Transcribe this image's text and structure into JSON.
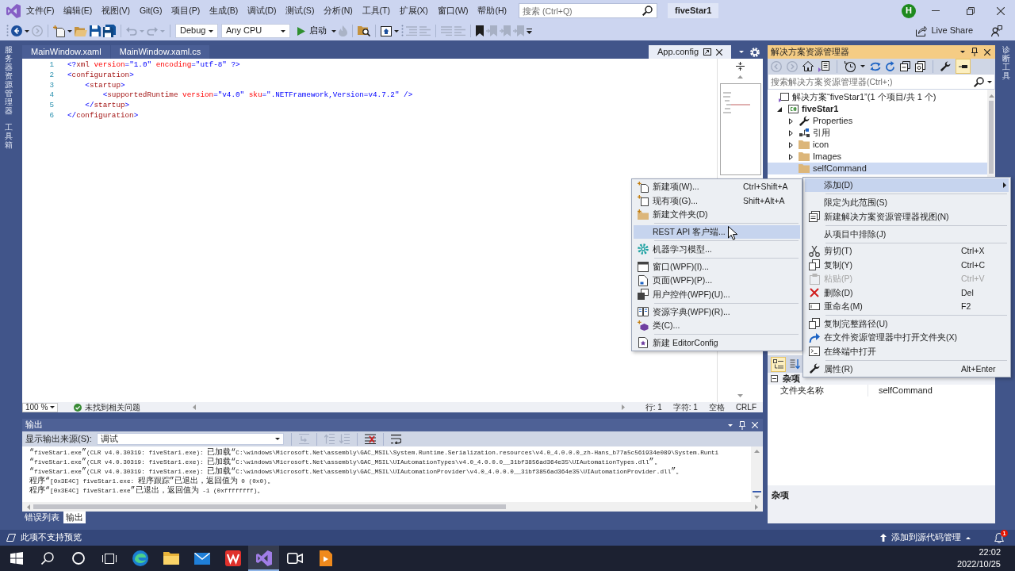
{
  "title_bar": {
    "menu": [
      "文件(F)",
      "编辑(E)",
      "视图(V)",
      "Git(G)",
      "项目(P)",
      "生成(B)",
      "调试(D)",
      "测试(S)",
      "分析(N)",
      "工具(T)",
      "扩展(X)",
      "窗口(W)",
      "帮助(H)"
    ],
    "search": {
      "placeholder": "搜索 (Ctrl+Q)"
    },
    "solution": "fiveStar1",
    "avatar": "H"
  },
  "toolbar": {
    "configuration": "Debug",
    "platform": "Any CPU",
    "start": "启动",
    "live_share": "Live Share"
  },
  "side_tabs_left": [
    "服务器资源管理器",
    "工具箱"
  ],
  "editor": {
    "tabs": [
      {
        "label": "MainWindow.xaml",
        "kind": "document",
        "selected": false
      },
      {
        "label": "MainWindow.xaml.cs",
        "kind": "document",
        "selected": false
      },
      {
        "label": "App.config",
        "kind": "preview",
        "selected": true
      }
    ],
    "lines": [
      {
        "number": "1",
        "tokens": [
          {
            "kind": "delimiter",
            "text": "<?"
          },
          {
            "kind": "name",
            "text": "xml"
          },
          {
            "kind": "attribute",
            "text": " version"
          },
          {
            "kind": "value",
            "text": "=\"1.0\""
          },
          {
            "kind": "attribute",
            "text": " encoding"
          },
          {
            "kind": "value",
            "text": "=\"utf-8\""
          },
          {
            "kind": "delimiter",
            "text": " ?>"
          }
        ]
      },
      {
        "number": "2",
        "tokens": [
          {
            "kind": "delimiter",
            "text": "<"
          },
          {
            "kind": "name",
            "text": "configuration"
          },
          {
            "kind": "delimiter",
            "text": ">"
          }
        ]
      },
      {
        "number": "3",
        "tokens": [
          {
            "kind": "delimiter",
            "text": "    <"
          },
          {
            "kind": "name",
            "text": "startup"
          },
          {
            "kind": "delimiter",
            "text": ">"
          }
        ]
      },
      {
        "number": "4",
        "tokens": [
          {
            "kind": "delimiter",
            "text": "        <"
          },
          {
            "kind": "name",
            "text": "supportedRuntime"
          },
          {
            "kind": "attribute",
            "text": " version"
          },
          {
            "kind": "value",
            "text": "=\"v4.0\""
          },
          {
            "kind": "attribute",
            "text": " sku"
          },
          {
            "kind": "value",
            "text": "=\".NETFramework,Version=v4.7.2\""
          },
          {
            "kind": "delimiter",
            "text": " />"
          }
        ]
      },
      {
        "number": "5",
        "tokens": [
          {
            "kind": "delimiter",
            "text": "    </"
          },
          {
            "kind": "name",
            "text": "startup"
          },
          {
            "kind": "delimiter",
            "text": ">"
          }
        ]
      },
      {
        "number": "6",
        "tokens": [
          {
            "kind": "delimiter",
            "text": "</"
          },
          {
            "kind": "name",
            "text": "configuration"
          },
          {
            "kind": "delimiter",
            "text": ">"
          }
        ]
      }
    ],
    "zoom": "100 %",
    "issues": "未找到相关问题",
    "line": "行: 1",
    "column": "字符: 1",
    "indent": "空格",
    "line_ending": "CRLF"
  },
  "output": {
    "title": "输出",
    "source_label": "显示输出来源(S):",
    "source": "调试",
    "lines": [
      "“fiveStar1.exe”(CLR v4.0.30319: fiveStar1.exe): 已加载“C:\\windows\\Microsoft.Net\\assembly\\GAC_MSIL\\System.Runtime.Serialization.resources\\v4.0_4.0.0.0_zh-Hans_b77a5c561934e089\\System.Runti",
      "“fiveStar1.exe”(CLR v4.0.30319: fiveStar1.exe): 已加载“C:\\windows\\Microsoft.Net\\assembly\\GAC_MSIL\\UIAutomationTypes\\v4.0_4.0.0.0__31bf3856ad364e35\\UIAutomationTypes.dll”。",
      "“fiveStar1.exe”(CLR v4.0.30319: fiveStar1.exe): 已加载“C:\\windows\\Microsoft.Net\\assembly\\GAC_MSIL\\UIAutomationProvider\\v4.0_4.0.0.0__31bf3856ad364e35\\UIAutomationProvider.dll”。",
      "程序“[0x3E4C] fiveStar1.exe: 程序跟踪”已退出，返回值为 0 (0x0)。",
      "程序“[0x3E4C] fiveStar1.exe”已退出，返回值为 -1 (0xffffffff)。"
    ],
    "tabs": [
      {
        "label": "错误列表",
        "selected": false
      },
      {
        "label": "输出",
        "selected": true
      }
    ]
  },
  "solution_explorer": {
    "title": "解决方案资源管理器",
    "toolbar_toggle": {
      "on": true
    },
    "search": {
      "placeholder": "搜索解决方案资源管理器(Ctrl+;)"
    },
    "tree": [
      {
        "label": "解决方案“fiveStar1”(1 个项目/共 1 个)",
        "kind": "solution",
        "selected": false,
        "children": [
          {
            "label": "fiveStar1",
            "kind": "project",
            "expanded": true,
            "selected": false,
            "children": [
              {
                "label": "Properties",
                "kind": "properties",
                "expanded": false,
                "selected": false
              },
              {
                "label": "引用",
                "kind": "references",
                "expanded": false,
                "selected": false
              },
              {
                "label": "icon",
                "kind": "folder",
                "expanded": false,
                "selected": false
              },
              {
                "label": "Images",
                "kind": "folder",
                "expanded": false,
                "selected": false
              },
              {
                "label": "selfCommand",
                "kind": "folder",
                "selected": true
              }
            ]
          }
        ]
      }
    ]
  },
  "properties": {
    "sort_buttons": [
      {
        "selected": true
      },
      {
        "selected": false
      }
    ],
    "category": "杂项",
    "rows": [
      {
        "name": "文件夹名称",
        "value": "selfCommand"
      }
    ],
    "description": "杂项"
  },
  "side_tabs_right": [
    "诊断工具"
  ],
  "context_menu": {
    "groups": [
      [
        {
          "label": "添加(D)",
          "selected": true,
          "disabled": false,
          "submenu": true
        }
      ],
      [
        {
          "label": "限定为此范围(S)",
          "selected": false,
          "disabled": false,
          "submenu": false
        },
        {
          "label": "新建解决方案资源管理器视图(N)",
          "selected": false,
          "disabled": false,
          "submenu": false
        }
      ],
      [
        {
          "label": "从项目中排除(J)",
          "selected": false,
          "disabled": false,
          "submenu": false
        }
      ],
      [
        {
          "label": "剪切(T)",
          "shortcut": "Ctrl+X",
          "selected": false,
          "disabled": false,
          "submenu": false
        },
        {
          "label": "复制(Y)",
          "shortcut": "Ctrl+C",
          "selected": false,
          "disabled": false,
          "submenu": false
        },
        {
          "label": "粘贴(P)",
          "shortcut": "Ctrl+V",
          "selected": false,
          "disabled": true,
          "submenu": false
        },
        {
          "label": "删除(D)",
          "shortcut": "Del",
          "selected": false,
          "disabled": false,
          "submenu": false
        },
        {
          "label": "重命名(M)",
          "shortcut": "F2",
          "selected": false,
          "disabled": false,
          "submenu": false
        }
      ],
      [
        {
          "label": "复制完整路径(U)",
          "selected": false,
          "disabled": false,
          "submenu": false
        },
        {
          "label": "在文件资源管理器中打开文件夹(X)",
          "selected": false,
          "disabled": false,
          "submenu": false
        },
        {
          "label": "在终端中打开",
          "selected": false,
          "disabled": false,
          "submenu": false
        }
      ],
      [
        {
          "label": "属性(R)",
          "shortcut": "Alt+Enter",
          "selected": false,
          "disabled": false,
          "submenu": false
        }
      ]
    ]
  },
  "submenu": {
    "groups": [
      [
        {
          "label": "新建项(W)...",
          "shortcut": "Ctrl+Shift+A",
          "selected": false,
          "disabled": false,
          "submenu": false
        },
        {
          "label": "现有项(G)...",
          "shortcut": "Shift+Alt+A",
          "selected": false,
          "disabled": false,
          "submenu": false
        },
        {
          "label": "新建文件夹(D)",
          "selected": false,
          "disabled": false,
          "submenu": false
        }
      ],
      [
        {
          "label": "REST API 客户端...",
          "selected": true,
          "disabled": false,
          "submenu": false
        }
      ],
      [
        {
          "label": "机器学习模型...",
          "selected": false,
          "disabled": false,
          "submenu": false
        }
      ],
      [
        {
          "label": "窗口(WPF)(I)...",
          "selected": false,
          "disabled": false,
          "submenu": false
        },
        {
          "label": "页面(WPF)(P)...",
          "selected": false,
          "disabled": false,
          "submenu": false
        },
        {
          "label": "用户控件(WPF)(U)...",
          "selected": false,
          "disabled": false,
          "submenu": false
        }
      ],
      [
        {
          "label": "资源字典(WPF)(R)...",
          "selected": false,
          "disabled": false,
          "submenu": false
        },
        {
          "label": "类(C)...",
          "selected": false,
          "disabled": false,
          "submenu": false
        }
      ],
      [
        {
          "label": "新建 EditorConfig",
          "selected": false,
          "disabled": false,
          "submenu": false
        }
      ]
    ]
  },
  "status_bar": {
    "message": "此项不支持预览",
    "source_control": "添加到源代码管理",
    "notifications": "1"
  },
  "taskbar": {
    "apps": [
      {
        "selected": false
      },
      {
        "selected": false
      },
      {
        "selected": false
      },
      {
        "selected": false
      },
      {
        "selected": true
      },
      {
        "selected": false
      },
      {
        "selected": false
      }
    ],
    "time": "22:02",
    "date": "2022/10/25"
  }
}
